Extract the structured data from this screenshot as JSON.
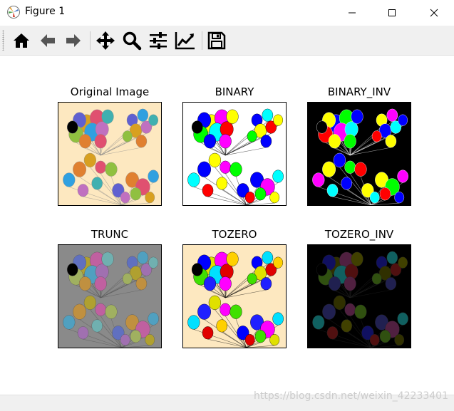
{
  "window": {
    "title": "Figure 1"
  },
  "toolbar": {
    "buttons": [
      "home-icon",
      "back-icon",
      "forward-icon",
      "pan-icon",
      "zoom-icon",
      "configure-subplots-icon",
      "edit-axis-icon",
      "save-icon"
    ]
  },
  "subplots": [
    {
      "title": "Original Image",
      "variant": "original"
    },
    {
      "title": "BINARY",
      "variant": "binary"
    },
    {
      "title": "BINARY_INV",
      "variant": "binary_inv"
    },
    {
      "title": "TRUNC",
      "variant": "trunc"
    },
    {
      "title": "TOZERO",
      "variant": "tozero"
    },
    {
      "title": "TOZERO_INV",
      "variant": "tozero_inv"
    }
  ],
  "watermark": "https://blog.csdn.net/weixin_42233401",
  "colors": {
    "cream_bg": "#fde8c0",
    "trunc_bg": "#8a8a8a",
    "black": "#000000"
  }
}
